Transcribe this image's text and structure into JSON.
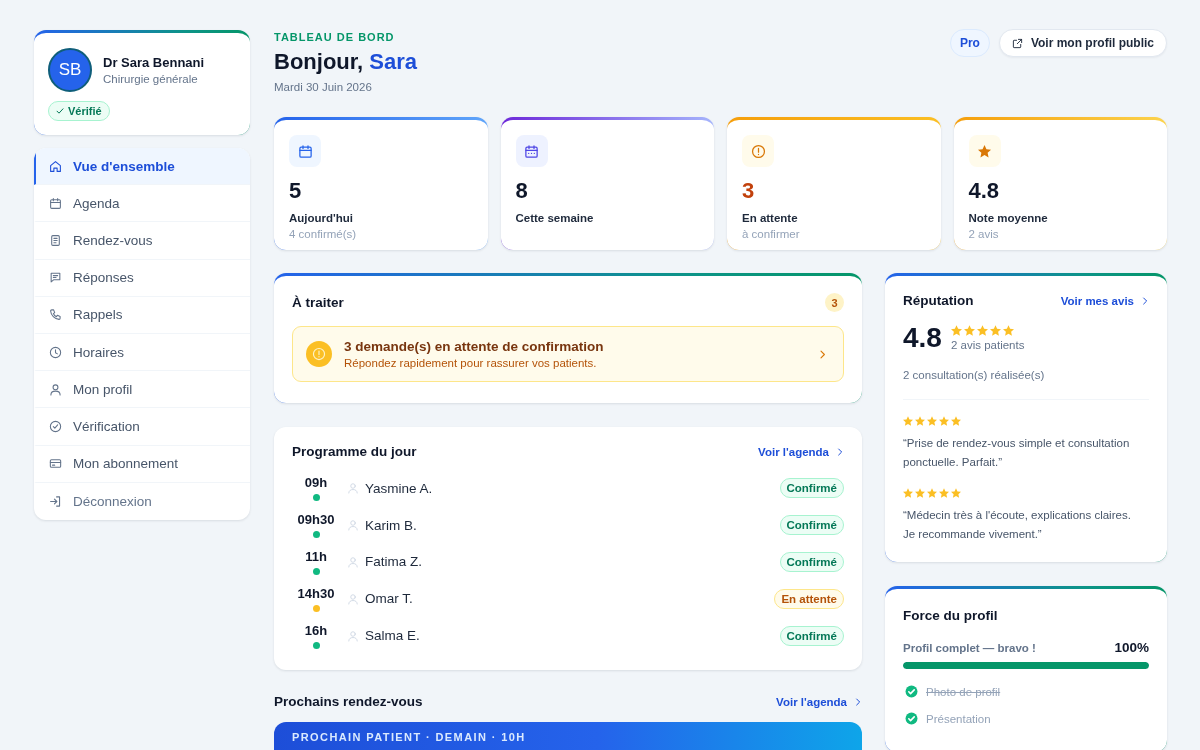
{
  "sidebar": {
    "profile": {
      "initials": "SB",
      "name": "Dr Sara Bennani",
      "specialty": "Chirurgie générale",
      "badge": "Vérifié"
    },
    "nav": [
      {
        "label": "Vue d'ensemble",
        "kind": "overview",
        "selected": true
      },
      {
        "label": "Agenda",
        "kind": "agenda",
        "selected": false
      },
      {
        "label": "Rendez-vous",
        "kind": "appointments",
        "selected": false
      },
      {
        "label": "Réponses",
        "kind": "replies",
        "selected": false
      },
      {
        "label": "Rappels",
        "kind": "reminders",
        "selected": false
      },
      {
        "label": "Horaires",
        "kind": "hours",
        "selected": false
      },
      {
        "label": "Mon profil",
        "kind": "profile",
        "selected": false
      },
      {
        "label": "Vérification",
        "kind": "verification",
        "selected": false
      },
      {
        "label": "Mon abonnement",
        "kind": "subscription",
        "selected": false
      },
      {
        "label": "Déconnexion",
        "kind": "logout",
        "selected": false
      }
    ]
  },
  "header": {
    "eyebrow": "TABLEAU DE BORD",
    "greeting": "Bonjour,",
    "name": "Sara",
    "date": "Mardi 30 Juin 2026",
    "plan": "Pro",
    "profile_button": "Voir mon profil public"
  },
  "stats": [
    {
      "kind": "today",
      "value": "5",
      "label": "Aujourd'hui",
      "sub": "4 confirmé(s)"
    },
    {
      "kind": "week",
      "value": "8",
      "label": "Cette semaine"
    },
    {
      "kind": "pending",
      "value": "3",
      "label": "En attente",
      "sub": "à confirmer"
    },
    {
      "kind": "rating",
      "value": "4.8",
      "label": "Note moyenne",
      "sub": "2 avis"
    }
  ],
  "todo": {
    "title": "À traiter",
    "count": "3",
    "alert": {
      "title": "3 demande(s) en attente de confirmation",
      "text": "Répondez rapidement pour rassurer vos patients."
    }
  },
  "schedule": {
    "title": "Programme du jour",
    "link": "Voir l'agenda",
    "rows": [
      {
        "time": "09h",
        "patient": "Yasmine A.",
        "status": "Confirmé",
        "kind": "confirmed"
      },
      {
        "time": "09h30",
        "patient": "Karim B.",
        "status": "Confirmé",
        "kind": "confirmed"
      },
      {
        "time": "11h",
        "patient": "Fatima Z.",
        "status": "Confirmé",
        "kind": "confirmed"
      },
      {
        "time": "14h30",
        "patient": "Omar T.",
        "status": "En attente",
        "kind": "pending"
      },
      {
        "time": "16h",
        "patient": "Salma E.",
        "status": "Confirmé",
        "kind": "confirmed"
      }
    ]
  },
  "upcoming": {
    "title": "Prochains rendez-vous",
    "link": "Voir l'agenda",
    "next_label": "PROCHAIN PATIENT · DEMAIN · 10H"
  },
  "reputation": {
    "title": "Réputation",
    "link": "Voir mes avis",
    "rating": "4.8",
    "stars": 5,
    "count": "2 avis patients",
    "consultations": "2 consultation(s) réalisée(s)",
    "reviews": [
      {
        "stars": 5,
        "text": "“Prise de rendez-vous simple et consultation ponctuelle. Parfait.”"
      },
      {
        "stars": 5,
        "text": "“Médecin très à l'écoute, explications claires. Je recommande vivement.”"
      }
    ]
  },
  "profile_strength": {
    "title": "Force du profil",
    "label": "Profil complet — bravo !",
    "percent": "100%",
    "level": 1,
    "items": [
      {
        "label": "Photo de profil",
        "checked": true,
        "struck": true
      },
      {
        "label": "Présentation",
        "checked": true,
        "struck": false
      }
    ]
  }
}
